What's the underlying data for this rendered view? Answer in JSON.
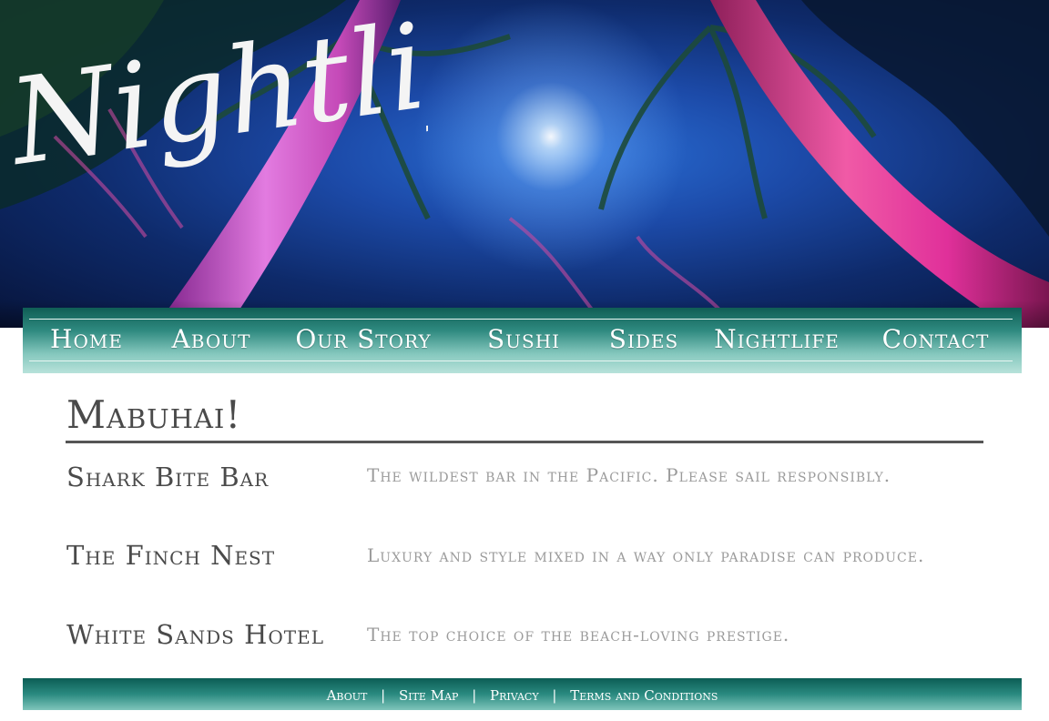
{
  "hero": {
    "script_title": "Nightlife"
  },
  "nav": {
    "items": [
      {
        "label": "Home"
      },
      {
        "label": "About"
      },
      {
        "label": "Our Story"
      },
      {
        "label": "Sushi"
      },
      {
        "label": "Sides"
      },
      {
        "label": "Nightlife"
      },
      {
        "label": "Contact"
      }
    ]
  },
  "main": {
    "title": "Mabuhai!",
    "venues": [
      {
        "name": "Shark Bite Bar",
        "description": "The wildest bar in the Pacific. Please sail responsibly."
      },
      {
        "name": "The Finch Nest",
        "description": "Luxury and style mixed in a way only paradise can produce."
      },
      {
        "name": "White Sands Hotel",
        "description": "The top choice of the beach-loving prestige."
      }
    ]
  },
  "footer": {
    "links": [
      {
        "label": "About"
      },
      {
        "label": "Site Map"
      },
      {
        "label": "Privacy"
      },
      {
        "label": "Terms and Conditions"
      }
    ],
    "separator": "|"
  },
  "colors": {
    "nav_teal_dark": "#0f5e55",
    "nav_teal_light": "#b8e2da",
    "heading_gray": "#4a4a4a",
    "desc_gray": "#9b9b9b",
    "palm_pink": "#e0309a"
  }
}
